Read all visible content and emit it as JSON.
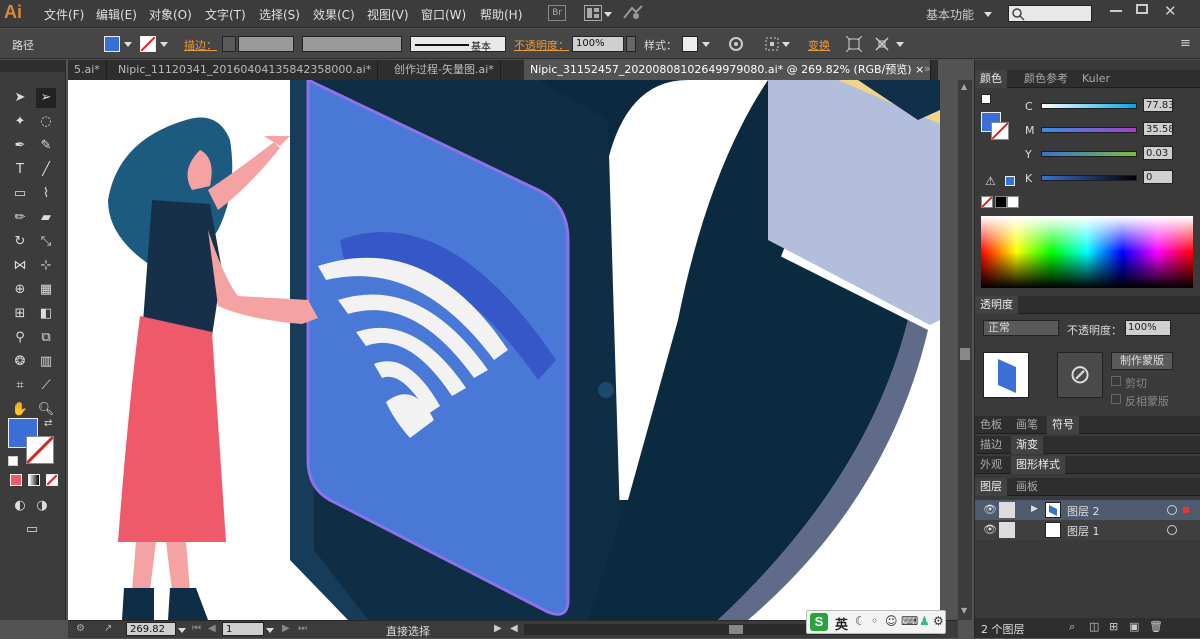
{
  "app": {
    "logo": "Ai"
  },
  "menu": [
    "文件(F)",
    "编辑(E)",
    "对象(O)",
    "文字(T)",
    "选择(S)",
    "效果(C)",
    "视图(V)",
    "窗口(W)",
    "帮助(H)"
  ],
  "menu_extra": {
    "br_label": "Br",
    "workspace": "基本功能"
  },
  "control": {
    "object_type": "路径",
    "stroke_label": "描边：",
    "brush_label": "基本",
    "opacity_label": "不透明度：",
    "opacity_value": "100%",
    "style_label": "样式：",
    "transform_label": "变换"
  },
  "tabs": [
    {
      "label": "5.ai*"
    },
    {
      "label": "Nipic_11120341_20160404135842358000.ai*"
    },
    {
      "label": "创作过程-矢量图.ai*"
    },
    {
      "label": "Nipic_31152457_20200808102649979080.ai* @ 269.82% (RGB/预览)"
    }
  ],
  "tab_close": "×",
  "status": {
    "zoom": "269.82",
    "artboard": "1",
    "tool_name": "直接选择"
  },
  "color_panel": {
    "tabs": [
      "颜色",
      "颜色参考",
      "Kuler"
    ],
    "channels": [
      {
        "name": "C",
        "value": "77.83"
      },
      {
        "name": "M",
        "value": "35.58"
      },
      {
        "name": "Y",
        "value": "0.03"
      },
      {
        "name": "K",
        "value": "0"
      }
    ]
  },
  "transparency_panel": {
    "title": "透明度",
    "blend_mode": "正常",
    "opacity_label": "不透明度：",
    "opacity_value": "100%",
    "make_mask": "制作蒙版",
    "clip": "剪切",
    "invert_mask": "反相蒙版"
  },
  "panel_groups": [
    {
      "tabs": [
        "色板",
        "画笔",
        "符号"
      ],
      "active": 2
    },
    {
      "tabs": [
        "描边",
        "渐变"
      ],
      "active": 1
    },
    {
      "tabs": [
        "外观",
        "图形样式"
      ],
      "active": 1
    }
  ],
  "layers_panel": {
    "tabs": [
      "图层",
      "画板"
    ],
    "layers": [
      {
        "name": "图层 2"
      },
      {
        "name": "图层 1"
      }
    ],
    "footer": "2 个图层"
  },
  "ime": {
    "logo": "S",
    "lang": "英"
  },
  "colors": {
    "fill": "#3a6fd8",
    "accent_orange": "#e89a3c",
    "screen_blue": "#4a78d6",
    "deep_navy": "#0f2e46",
    "band_navy": "#0b2a3f",
    "dress_pink": "#ef5a6a",
    "skin": "#f5a3a2",
    "hair": "#1d5a80",
    "top_dark": "#17304a",
    "selection_purple": "#8c73e8"
  }
}
